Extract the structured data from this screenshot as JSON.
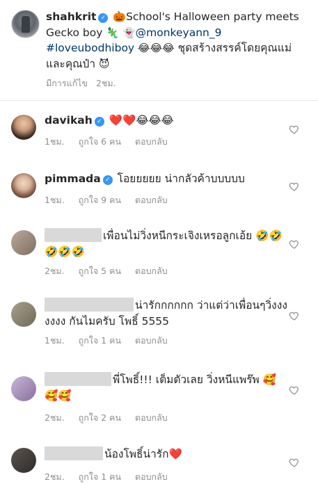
{
  "caption": {
    "username": "shahkrit",
    "segment_1": "School's Halloween party meets Gecko boy",
    "mention": "@monkeyann_9",
    "hashtag": "#loveubodhiboy",
    "laughs": "😂😂😂",
    "thai_text": "ชุดสร้างสรรค์โดยคุณแม่และคุณป๋า",
    "end_emoji": "😈",
    "pumpkin": "🎃",
    "lizard": "🦎",
    "ghost": "👻",
    "edited": "มีการแก้ไข",
    "time": "2ชม."
  },
  "comments": [
    {
      "username": "davikah",
      "verified": true,
      "text": "❤️❤️😂😂😂",
      "time": "1ชม.",
      "likes": "ถูกใจ 6 คน",
      "reply": "ตอบกลับ"
    },
    {
      "username": "pimmada",
      "verified": true,
      "text": "โอยยยยย น่ากลัวค้าบบบบบ",
      "time": "1ชม.",
      "likes": "ถูกใจ 9 คน",
      "reply": "ตอบกลับ"
    },
    {
      "username": "",
      "text": "เพื่อนไม่วิ่งหนีกระเจิงเหรอลูกเอ้ย 🤣🤣🤣🤣🤣",
      "time": "2ชม.",
      "likes": "ถูกใจ 5 คน",
      "reply": "ตอบกลับ"
    },
    {
      "username": "",
      "text": "น่ารักกกกกก ว่าแต่ว่าเพื่อนๆวิ่งงงงงงง กันไมครับ โพธิ์ 5555",
      "time": "1ชม.",
      "likes": "ถูกใจ 1 คน",
      "reply": "ตอบกลับ"
    },
    {
      "username": "",
      "text": "พี่โพธิ์!!! เต็มตัวเลย วิ่งหนีแพร๊พ 🥰🥰🥰",
      "time": "2ชม.",
      "likes": "ถูกใจ 2 คน",
      "reply": "ตอบกลับ"
    },
    {
      "username": "",
      "text": "น้องโพธิ์น่ารัก❤️",
      "time": "2ชม.",
      "likes": "ถูกใจ 1 คน",
      "reply": "ตอบกลับ"
    }
  ],
  "colors": {
    "link": "#003569",
    "verified": "#3897f0",
    "meta": "#8e8e8e",
    "text": "#262626"
  },
  "icons": {
    "verified": "verified-badge-icon",
    "like": "heart-outline-icon"
  }
}
